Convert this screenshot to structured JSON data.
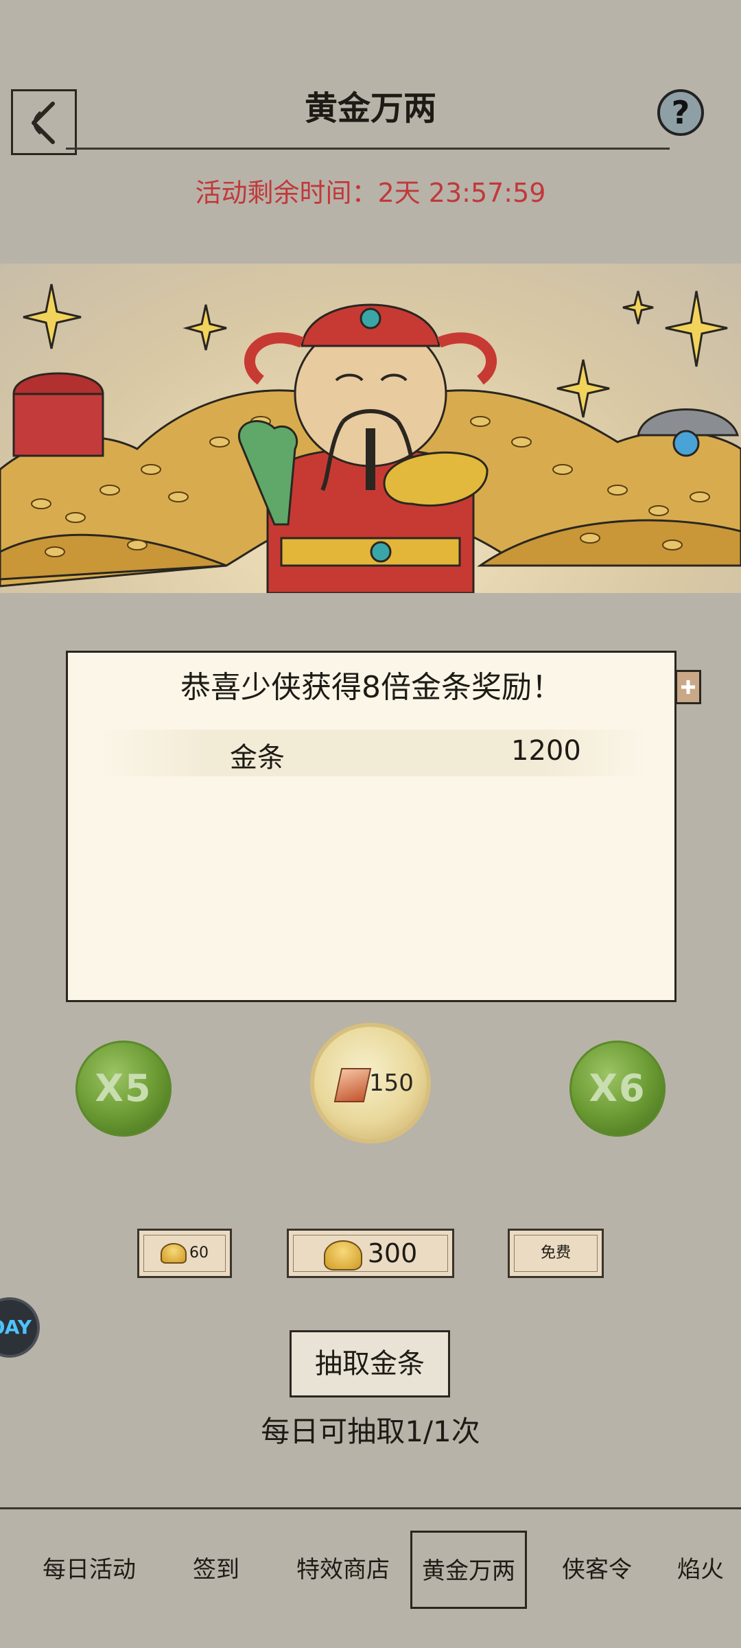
{
  "header": {
    "title": "黄金万两",
    "help_label": "?",
    "timer_text": "活动剩余时间：2天 23:57:59"
  },
  "reward_panel": {
    "title": "恭喜少侠获得8倍金条奖励！",
    "items": [
      {
        "name": "金条",
        "count": "1200"
      }
    ]
  },
  "multipliers": {
    "left": "X5",
    "right": "X6"
  },
  "coin": {
    "value": "150"
  },
  "costs": [
    {
      "value": "60"
    },
    {
      "value": "300"
    },
    {
      "value": "免费"
    }
  ],
  "draw": {
    "button_label": "抽取金条",
    "daily_limit": "每日可抽取1/1次"
  },
  "bottom_nav": {
    "items": [
      "每日活动",
      "签到",
      "特效商店",
      "黄金万两",
      "侠客令",
      "焰火"
    ],
    "active_index": 3
  },
  "side_avatar_text": "ÓAY",
  "colors": {
    "background": "#b8b3a8",
    "timer_red": "#c0393b",
    "panel_bg": "#fbf6e8",
    "orb_green": "#6b9a33",
    "gold": "#d09b25"
  }
}
